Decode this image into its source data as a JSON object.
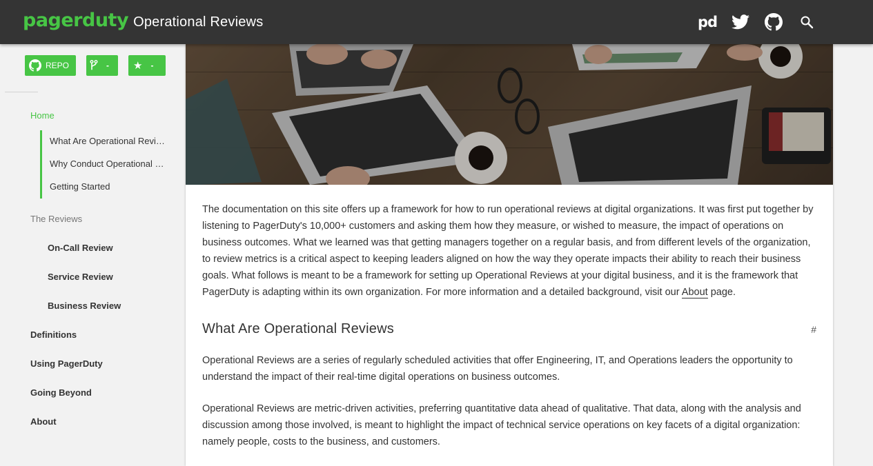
{
  "header": {
    "logo": "pagerduty",
    "title": "Operational Reviews",
    "icons": [
      "pagerduty-icon",
      "twitter-icon",
      "github-icon",
      "search-icon"
    ]
  },
  "sidebar": {
    "badges": {
      "repo_label": "REPO",
      "fork_count": "-",
      "star_count": "-"
    },
    "home": "Home",
    "toc": [
      "What Are Operational Reviews",
      "Why Conduct Operational Reviews",
      "Getting Started"
    ],
    "section_label": "The Reviews",
    "reviews": [
      "On-Call Review",
      "Service Review",
      "Business Review"
    ],
    "items": [
      "Definitions",
      "Using PagerDuty",
      "Going Beyond",
      "About"
    ]
  },
  "main": {
    "intro_before_link": "The documentation on this site offers up a framework for how to run operational reviews at digital organizations. It was first put together by listening to PagerDuty's 10,000+ customers and asking them how they measure, or wished to measure, the impact of operations on business outcomes. What we learned was that getting managers together on a regular basis, and from different levels of the organization, to review metrics is a critical aspect to keeping leaders aligned on how the way they operate impacts their ability to reach their business goals. What follows is meant to be a framework for setting up Operational Reviews at your digital business, and it is the framework that PagerDuty is adapting within its own organization. For more information and a detailed background, visit our ",
    "intro_link": "About",
    "intro_after_link": " page.",
    "heading": "What Are Operational Reviews",
    "heading_anchor": "#",
    "para1": "Operational Reviews are a series of regularly scheduled activities that offer Engineering, IT, and Operations leaders the opportunity to understand the impact of their real-time digital operations on business outcomes.",
    "para2": "Operational Reviews are metric-driven activities, preferring quantitative data ahead of qualitative. That data, along with the analysis and discussion among those involved, is meant to highlight the impact of technical service operations on key facets of a digital organization: namely people, costs to the business, and customers."
  },
  "colors": {
    "accent": "#47c545",
    "header_bg": "#343434",
    "sidebar_bg": "#f2f2f2"
  }
}
